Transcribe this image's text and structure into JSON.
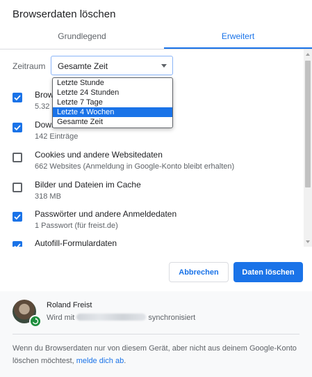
{
  "dialog": {
    "title": "Browserdaten löschen"
  },
  "tabs": [
    {
      "label": "Grundlegend",
      "active": false
    },
    {
      "label": "Erweitert",
      "active": true
    }
  ],
  "time_range": {
    "label": "Zeitraum",
    "selected_value": "Gesamte Zeit",
    "options": [
      "Letzte Stunde",
      "Letzte 24 Stunden",
      "Letzte 7 Tage",
      "Letzte 4 Wochen",
      "Gesamte Zeit"
    ],
    "highlighted_option": "Letzte 4 Wochen"
  },
  "items": [
    {
      "title": "Brow",
      "subtitle": "5.32",
      "checked": true
    },
    {
      "title": "Down",
      "subtitle": "142 Einträge",
      "checked": true
    },
    {
      "title": "Cookies und andere Websitedaten",
      "subtitle": "662 Websites (Anmeldung in Google-Konto bleibt erhalten)",
      "checked": false
    },
    {
      "title": "Bilder und Dateien im Cache",
      "subtitle": "318 MB",
      "checked": false
    },
    {
      "title": "Passwörter und andere Anmeldedaten",
      "subtitle": "1 Passwort (für freist.de)",
      "checked": true
    },
    {
      "title": "Autofill-Formulardaten",
      "subtitle": "",
      "checked": true
    }
  ],
  "buttons": {
    "cancel": "Abbrechen",
    "clear": "Daten löschen"
  },
  "account": {
    "name": "Roland Freist",
    "sync_prefix": "Wird mit",
    "sync_suffix": "synchronisiert"
  },
  "info": {
    "text": "Wenn du Browserdaten nur von diesem Gerät, aber nicht aus deinem Google-Konto löschen möchtest, ",
    "link": "melde dich ab",
    "end": "."
  },
  "colors": {
    "accent": "#1a73e8",
    "sync_green": "#1e8e3e"
  }
}
